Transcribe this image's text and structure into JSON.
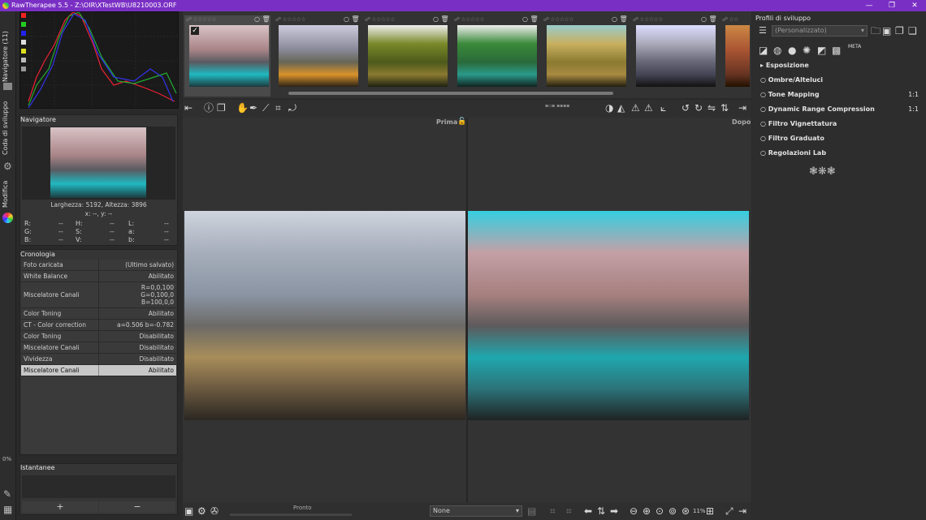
{
  "window": {
    "title": "RawTherapee 5.5 - Z:\\OIR\\XTestWB\\U8210003.ORF"
  },
  "sidebar_tabs": {
    "navigator": "Navigatore (11)",
    "queue": "Coda di sviluppo",
    "edit": "Modifica"
  },
  "navigator": {
    "title": "Navigatore",
    "size": "Larghezza: 5192, Altezza: 3896",
    "coords": "x: --, y: --",
    "rows": [
      [
        "R:",
        "--",
        "H:",
        "--",
        "L:",
        "--"
      ],
      [
        "G:",
        "--",
        "S:",
        "--",
        "a:",
        "--"
      ],
      [
        "B:",
        "--",
        "V:",
        "--",
        "b:",
        "--"
      ]
    ]
  },
  "history": {
    "title": "Cronologia",
    "rows": [
      {
        "name": "Foto caricata",
        "value": "(Ultimo salvato)"
      },
      {
        "name": "White Balance",
        "value": "Abilitato"
      },
      {
        "name": "Miscelatore Canali",
        "value": "R=0,0,100\nG=0,100,0\nB=100,0,0"
      },
      {
        "name": "Color Toning",
        "value": "Abilitato"
      },
      {
        "name": "CT - Color correction",
        "value": "a=0.506 b=-0.782"
      },
      {
        "name": "Color Toning",
        "value": "Disabilitato"
      },
      {
        "name": "Miscelatore Canali",
        "value": "Disabilitato"
      },
      {
        "name": "Vividezza",
        "value": "Disabilitato"
      },
      {
        "name": "Miscelatore Canali",
        "value": "Abilitato"
      }
    ]
  },
  "snapshots": {
    "title": "Istantanee",
    "add": "+",
    "remove": "−"
  },
  "left_pct": "0%",
  "viewer": {
    "before_label": "Prima",
    "after_label": "Dopo"
  },
  "profiles": {
    "title": "Profili di sviluppo",
    "selected": "(Personalizzato)"
  },
  "tools": [
    {
      "label": "Esposizione",
      "value": ""
    },
    {
      "label": "Ombre/Alteluci",
      "value": ""
    },
    {
      "label": "Tone Mapping",
      "value": "1:1"
    },
    {
      "label": "Dynamic Range Compression",
      "value": "1:1"
    },
    {
      "label": "Filtro Vignettatura",
      "value": ""
    },
    {
      "label": "Filtro Graduato",
      "value": ""
    },
    {
      "label": "Regolazioni Lab",
      "value": ""
    }
  ],
  "status": {
    "text": "Pronto",
    "zoom": "11%",
    "preview_select": "None"
  },
  "icons": {
    "meta": "META"
  }
}
